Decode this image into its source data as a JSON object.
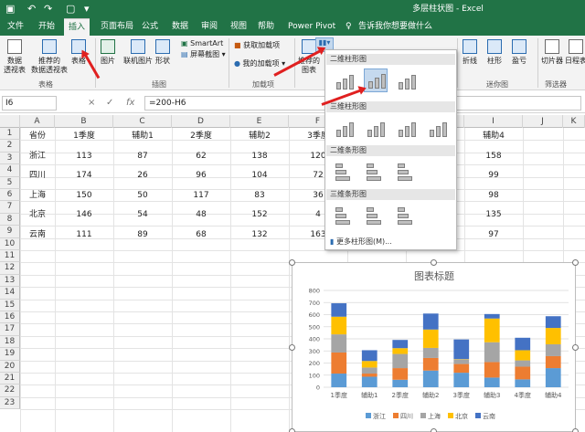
{
  "app": {
    "title": "多层柱状图  -  Excel"
  },
  "tabs": [
    "文件",
    "开始",
    "插入",
    "页面布局",
    "公式",
    "数据",
    "审阅",
    "视图",
    "帮助",
    "Power Pivot",
    "告诉我你想要做什么"
  ],
  "ribbon": {
    "buttons": [
      "数据\n透视表",
      "推荐的\n数据透视表",
      "表格",
      "图片",
      "联机图片",
      "形状",
      "SmartArt",
      "屏幕截图",
      "获取加载项",
      "我的加载项",
      "推荐的\n图表",
      "折线",
      "柱形",
      "盈亏",
      "切片器",
      "日程表"
    ],
    "groups": [
      "表格",
      "插图",
      "加载项",
      "迷你图",
      "筛选器"
    ]
  },
  "formula": {
    "namebox": "I6",
    "cancel": "×",
    "enter": "✓",
    "fx": "fx",
    "value": "=200-H6"
  },
  "columns": [
    "A",
    "B",
    "C",
    "D",
    "E",
    "F",
    "G",
    "H",
    "I",
    "J",
    "K"
  ],
  "rows": [
    "1",
    "2",
    "3",
    "4",
    "5",
    "6",
    "7",
    "8",
    "9",
    "10",
    "11",
    "12",
    "13",
    "14",
    "15",
    "16",
    "17",
    "18",
    "19",
    "20",
    "21",
    "22",
    "23"
  ],
  "table": {
    "header": [
      "省份",
      "1季度",
      "辅助1",
      "2季度",
      "辅助2",
      "3季度",
      "",
      "",
      "辅助4"
    ],
    "rows": [
      [
        "浙江",
        "113",
        "87",
        "62",
        "138",
        "120",
        "",
        "",
        "158"
      ],
      [
        "四川",
        "174",
        "26",
        "96",
        "104",
        "72",
        "",
        "",
        "99"
      ],
      [
        "上海",
        "150",
        "50",
        "117",
        "83",
        "36",
        "",
        "",
        "98"
      ],
      [
        "北京",
        "146",
        "54",
        "48",
        "152",
        "4",
        "",
        "",
        "135"
      ],
      [
        "云南",
        "111",
        "89",
        "68",
        "132",
        "163",
        "",
        "",
        "97"
      ]
    ]
  },
  "dropdown": {
    "sections": [
      "二维柱形图",
      "三维柱形图",
      "二维条形图",
      "三维条形图"
    ],
    "more": "更多柱形图(M)..."
  },
  "chart_data": {
    "type": "bar",
    "stacked": true,
    "title": "图表标题",
    "categories": [
      "1季度",
      "辅助1",
      "2季度",
      "辅助2",
      "3季度",
      "辅助3",
      "4季度",
      "辅助4"
    ],
    "ylim": [
      0,
      800
    ],
    "yticks": [
      "0",
      "100",
      "200",
      "300",
      "400",
      "500",
      "600",
      "700",
      "800"
    ],
    "legend": "bottom",
    "series": [
      {
        "name": "浙江",
        "color": "#5b9bd5",
        "values": [
          113,
          87,
          62,
          138,
          120,
          80,
          65,
          158
        ]
      },
      {
        "name": "四川",
        "color": "#ed7d31",
        "values": [
          174,
          26,
          96,
          104,
          72,
          128,
          105,
          99
        ]
      },
      {
        "name": "上海",
        "color": "#a5a5a5",
        "values": [
          150,
          50,
          117,
          83,
          36,
          164,
          52,
          98
        ]
      },
      {
        "name": "北京",
        "color": "#ffc000",
        "values": [
          146,
          54,
          48,
          152,
          4,
          196,
          84,
          135
        ]
      },
      {
        "name": "云南",
        "color": "#4472c4",
        "values": [
          111,
          89,
          68,
          132,
          163,
          37,
          103,
          97
        ]
      }
    ]
  }
}
